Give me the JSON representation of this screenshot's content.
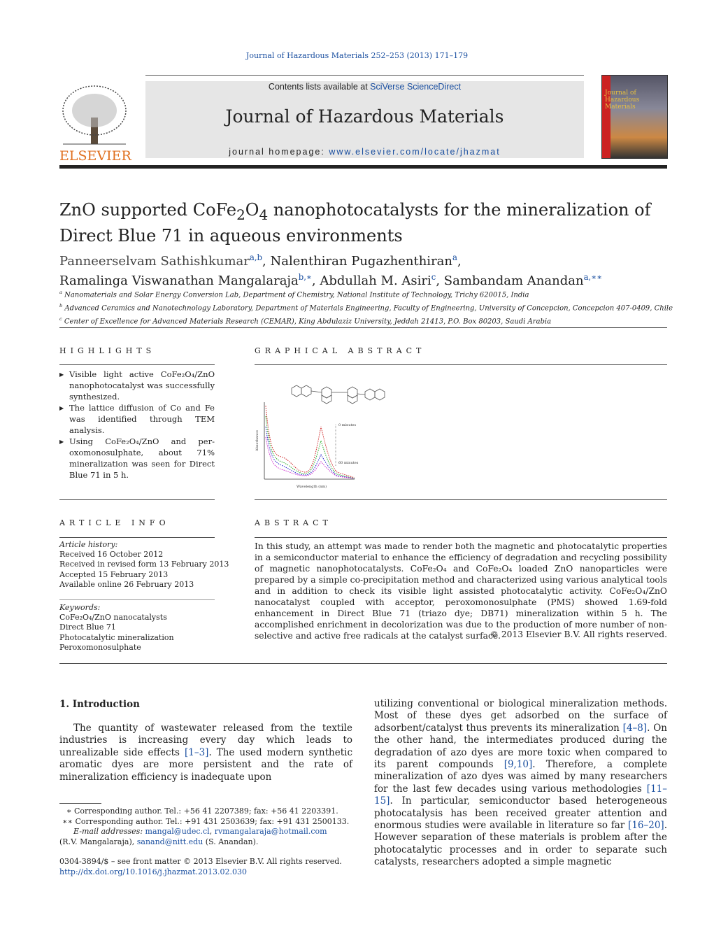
{
  "header": {
    "citation": "Journal of Hazardous Materials 252–253 (2013) 171–179",
    "contents_prefix": "Contents lists available at ",
    "contents_link": "SciVerse ScienceDirect",
    "journal_title": "Journal of Hazardous Materials",
    "homepage_prefix": "journal homepage: ",
    "homepage_link": "www.elsevier.com/locate/jhazmat",
    "publisher_logo": "ELSEVIER",
    "cover_text": "Journal of Hazardous Materials"
  },
  "article": {
    "title_part1": "ZnO supported CoFe",
    "title_sub1": "2",
    "title_part2": "O",
    "title_sub2": "4",
    "title_part3": " nanophotocatalysts for the mineralization of Direct Blue 71 in aqueous environments",
    "authors": [
      {
        "name": "Panneerselvam Sathishkumar",
        "sup": "a,b"
      },
      {
        "name": "Nalenthiran Pugazhenthiran",
        "sup": "a"
      },
      {
        "name": "Ramalinga Viswanathan Mangalaraja",
        "sup": "b,∗"
      },
      {
        "name": "Abdullah M. Asiri",
        "sup": "c"
      },
      {
        "name": "Sambandam Anandan",
        "sup": "a,∗∗"
      }
    ],
    "affiliations": [
      {
        "sup": "a",
        "text": "Nanomaterials and Solar Energy Conversion Lab, Department of Chemistry, National Institute of Technology, Trichy 620015, India"
      },
      {
        "sup": "b",
        "text": "Advanced Ceramics and Nanotechnology Laboratory, Department of Materials Engineering, Faculty of Engineering, University of Concepcion, Concepcion 407-0409, Chile"
      },
      {
        "sup": "c",
        "text": "Center of Excellence for Advanced Materials Research (CEMAR), King Abdulaziz University, Jeddah 21413, P.O. Box 80203, Saudi Arabia"
      }
    ]
  },
  "highlights": {
    "heading": "HIGHLIGHTS",
    "items": [
      "Visible light active CoFe₂O₄/ZnO nanophotocatalyst was successfully synthesized.",
      "The lattice diffusion of Co and Fe was identified through TEM analysis.",
      "Using CoFe₂O₄/ZnO and per-oxomonosulphate, about 71% mineralization was seen for Direct Blue 71 in 5 h."
    ]
  },
  "graphical_abstract": {
    "heading": "GRAPHICAL ABSTRACT",
    "ylabel": "Absorbance",
    "xlabel": "Wavelength (nm)",
    "label_top": "0 minutes",
    "label_bottom": "60 minutes"
  },
  "article_info": {
    "heading": "ARTICLE INFO",
    "history_label": "Article history:",
    "history": [
      "Received 16 October 2012",
      "Received in revised form 13 February 2013",
      "Accepted 15 February 2013",
      "Available online 26 February 2013"
    ],
    "keywords_label": "Keywords:",
    "keywords": [
      "CoFe₂O₄/ZnO nanocatalysts",
      "Direct Blue 71",
      "Photocatalytic mineralization",
      "Peroxomonosulphate"
    ]
  },
  "abstract": {
    "heading": "ABSTRACT",
    "text": "In this study, an attempt was made to render both the magnetic and photocatalytic properties in a semiconductor material to enhance the efficiency of degradation and recycling possibility of magnetic nanophotocatalysts. CoFe₂O₄ and CoFe₂O₄ loaded ZnO nanoparticles were prepared by a simple co-precipitation method and characterized using various analytical tools and in addition to check its visible light assisted photocatalytic activity. CoFe₂O₄/ZnO nanocatalyst coupled with acceptor, peroxomonosulphate (PMS) showed 1.69-fold enhancement in Direct Blue 71 (triazo dye; DB71) mineralization within 5 h. The accomplished enrichment in decolorization was due to the production of more number of non-selective and active free radicals at the catalyst surface.",
    "copyright": "© 2013 Elsevier B.V. All rights reserved."
  },
  "intro": {
    "heading": "1.  Introduction",
    "p1_a": "The quantity of wastewater released from the textile industries is increasing every day which leads to unrealizable side effects ",
    "p1_ref1": "[1–3]",
    "p1_b": ". The used modern synthetic aromatic dyes are more persistent and the rate of mineralization efficiency is inadequate upon",
    "col2_a": "utilizing conventional or biological mineralization methods. Most of these dyes get adsorbed on the surface of adsorbent/catalyst thus prevents its mineralization ",
    "ref2": "[4–8]",
    "col2_b": ". On the other hand, the intermediates produced during the degradation of azo dyes are more toxic when compared to its parent compounds ",
    "ref3": "[9,10]",
    "col2_c": ". Therefore, a complete mineralization of azo dyes was aimed by many researchers for the last few decades using various methodologies ",
    "ref4": "[11–15]",
    "col2_d": ". In particular, semiconductor based heterogeneous photocatalysis has been received greater attention and enormous studies were available in literature so far ",
    "ref5": "[16–20]",
    "col2_e": ". However separation of these materials is problem after the photocatalytic processes and in order to separate such catalysts, researchers adopted a simple magnetic"
  },
  "footnotes": {
    "fn1": "∗  Corresponding author. Tel.: +56 41 2207389; fax: +56 41 2203391.",
    "fn2": "∗∗  Corresponding author. Tel.: +91 431 2503639; fax: +91 431 2500133.",
    "email_label": "E-mail addresses: ",
    "email1": "mangal@udec.cl",
    "email2": "rvmangalaraja@hotmail.com",
    "email_suffix1": " (R.V. Mangalaraja), ",
    "email3": "sanand@nitt.edu",
    "email_suffix2": " (S. Anandan).",
    "front_matter": "0304-3894/$ – see front matter © 2013 Elsevier B.V. All rights reserved.",
    "doi": "http://dx.doi.org/10.1016/j.jhazmat.2013.02.030"
  }
}
